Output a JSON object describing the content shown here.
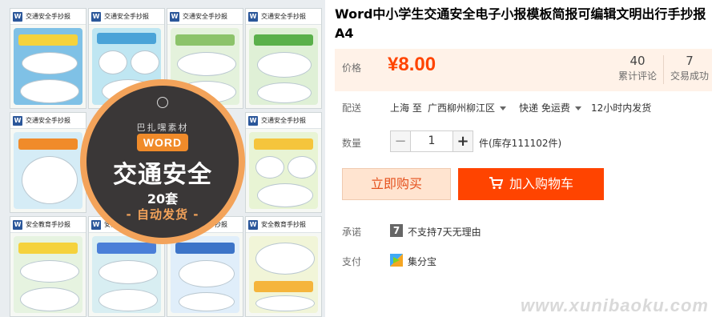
{
  "product_image": {
    "thumbnails": [
      {
        "header": "交通安全手抄报"
      },
      {
        "header": "交通安全手抄报"
      },
      {
        "header": "交通安全手抄报"
      },
      {
        "header": "交通安全手抄报"
      },
      {
        "header": "交通安全手抄报"
      },
      {
        "header": "交通安全手抄报"
      },
      {
        "header": "安全教育手抄报"
      },
      {
        "header": "安全教育手抄报"
      },
      {
        "header": "安全教育手抄报"
      },
      {
        "header": "安全教育手抄报"
      }
    ],
    "badge": {
      "brand": "巴扎嘿素材",
      "format": "WORD",
      "title": "交通安全",
      "count": "20套",
      "delivery": "- 自动发货 -"
    },
    "word_icon_letter": "W"
  },
  "product": {
    "title": "Word中小学生交通安全电子小报模板简报可编辑文明出行手抄报A4"
  },
  "price": {
    "label": "价格",
    "value": "¥8.00",
    "reviews_count": "40",
    "reviews_label": "累计评论",
    "sales_count": "7",
    "sales_label": "交易成功"
  },
  "shipping": {
    "label": "配送",
    "from": "上海 至",
    "to": "广西柳州柳江区",
    "method": "快递 免运费",
    "dispatch": "12小时内发货"
  },
  "quantity": {
    "label": "数量",
    "value": "1",
    "minus": "−",
    "plus": "+",
    "stock": "件(库存111102件)"
  },
  "actions": {
    "buy_now": "立即购买",
    "add_to_cart": "加入购物车"
  },
  "promise": {
    "label": "承诺",
    "icon_text": "7",
    "text": "不支持7天无理由"
  },
  "payment": {
    "label": "支付",
    "method": "集分宝"
  },
  "watermark": "www.xunibaoku.com",
  "colors": {
    "accent": "#ff4400",
    "price_bg": "#fff2e8",
    "buy_now_bg": "#ffe4d0",
    "badge_orange": "#f3a35a"
  },
  "icons": {
    "cart": "cart-icon",
    "caret": "chevron-down-icon",
    "promise": "seven-day-icon",
    "payment": "jifenbao-icon"
  }
}
